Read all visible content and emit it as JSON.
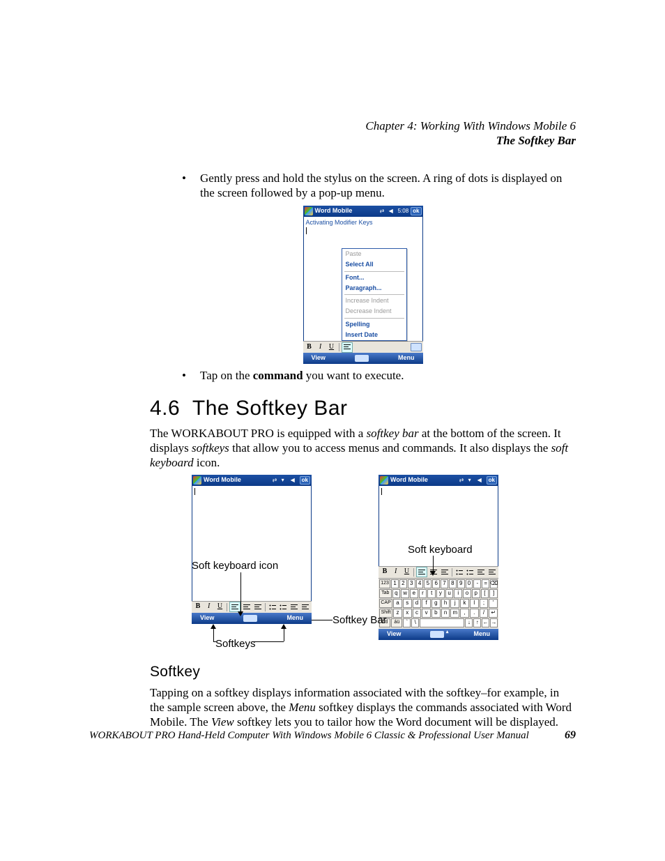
{
  "header": {
    "line1": "Chapter  4:  Working With Windows Mobile 6",
    "line2": "The Softkey Bar"
  },
  "bullets": {
    "b1": "Gently press and hold the stylus on the screen. A ring of dots is displayed on the screen followed by a pop-up menu.",
    "b2_pre": "Tap on the ",
    "b2_bold": "command",
    "b2_post": " you want to execute."
  },
  "section": {
    "num": "4.6",
    "title": "The Softkey Bar"
  },
  "para1": {
    "t1": "The WORKABOUT PRO is equipped with a ",
    "i1": "softkey bar",
    "t2": " at the bottom of the screen. It displays ",
    "i2": "softkeys",
    "t3": " that allow you to access menus and commands",
    "i3": ".",
    "t4": " It also displays the ",
    "i4": "soft keyboard",
    "t5": " icon."
  },
  "h3_softkey": "Softkey",
  "para2": {
    "t1": "Tapping on a softkey displays information associated with the softkey–for example, in the sample screen above, the ",
    "i1": "Menu",
    "t2": " softkey displays the commands associated with Word Mobile. The ",
    "i2": "View",
    "t3": " softkey lets you to tailor how the Word document will be displayed."
  },
  "footer": {
    "title": "WORKABOUT PRO Hand-Held Computer With Windows Mobile 6 Classic & Professional User Manual",
    "page": "69"
  },
  "device1": {
    "title": "Word Mobile",
    "time": "5:08",
    "ok": "ok",
    "doc": "Activating Modifier Keys",
    "menu": {
      "paste": "Paste",
      "selectall": "Select All",
      "font": "Font...",
      "paragraph": "Paragraph...",
      "incind": "Increase Indent",
      "decind": "Decrease Indent",
      "spelling": "Spelling",
      "insdate": "Insert Date"
    },
    "soft_view": "View",
    "soft_menu": "Menu"
  },
  "device2": {
    "title": "Word Mobile",
    "ok": "ok",
    "soft_view": "View",
    "soft_menu": "Menu"
  },
  "keyboard": {
    "r1_fn": "123",
    "r1": [
      "1",
      "2",
      "3",
      "4",
      "5",
      "6",
      "7",
      "8",
      "9",
      "0",
      "-",
      "="
    ],
    "r2_fn": "Tab",
    "r2": [
      "q",
      "w",
      "e",
      "r",
      "t",
      "y",
      "u",
      "i",
      "o",
      "p",
      "[",
      "]"
    ],
    "r3_fn": "CAP",
    "r3": [
      "a",
      "s",
      "d",
      "f",
      "g",
      "h",
      "j",
      "k",
      "l",
      ";",
      "'"
    ],
    "r4_fn": "Shift",
    "r4": [
      "z",
      "x",
      "c",
      "v",
      "b",
      "n",
      "m",
      ",",
      ".",
      "/"
    ],
    "r5_ctl": "Ctl",
    "r5_au": "áü"
  },
  "labels": {
    "softkb_icon": "Soft keyboard icon",
    "softkeys": "Softkeys",
    "softkey_bar": "Softkey Bar",
    "soft_keyboard": "Soft keyboard"
  }
}
